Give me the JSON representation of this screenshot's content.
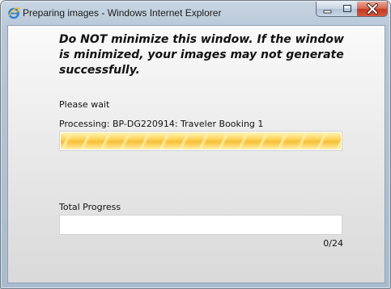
{
  "window": {
    "title": "Preparing images - Windows Internet Explorer",
    "icon": "internet-explorer-icon",
    "controls": {
      "minimize": "minimize-icon",
      "maximize": "maximize-icon",
      "close": "close-icon"
    },
    "close_color": "#c4381f"
  },
  "dialog": {
    "warning": "Do NOT minimize this window.  If the window is minimized, your images may not generate successfully.",
    "status_label": "Please wait",
    "processing_text": "Processing: BP-DG220914: Traveler Booking 1",
    "current_progress": 1,
    "current_bar_color": "#f5c03b",
    "total_label": "Total Progress",
    "total_done": 0,
    "total_count": 24,
    "total_progress_text": "0/24"
  }
}
